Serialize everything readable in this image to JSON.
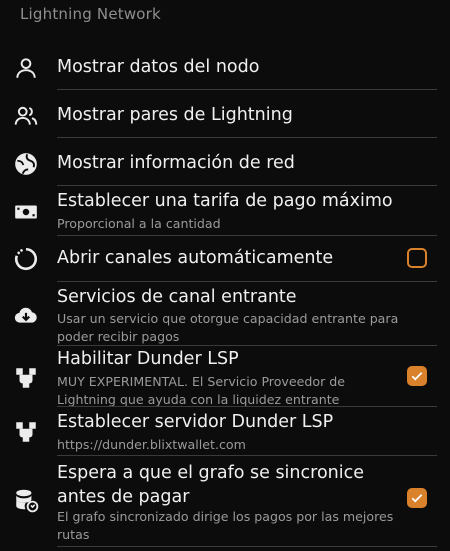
{
  "section": {
    "title": "Lightning Network"
  },
  "items": [
    {
      "icon": "person-icon",
      "title": "Mostrar datos del nodo"
    },
    {
      "icon": "people-icon",
      "title": "Mostrar pares de Lightning"
    },
    {
      "icon": "network-globe-icon",
      "title": "Mostrar información de red"
    },
    {
      "icon": "cash-icon",
      "title": "Establecer una tarifa de pago máximo",
      "subtitle": "Proporcional a la cantidad"
    },
    {
      "icon": "circle-progress-icon",
      "title": "Abrir canales automáticamente",
      "checked": false
    },
    {
      "icon": "cloud-download-icon",
      "title": "Servicios de canal entrante",
      "subtitle": "Usar un servicio que otorgue capacidad entrante para poder recibir pagos"
    },
    {
      "icon": "dunder-icon",
      "title": "Habilitar Dunder LSP",
      "subtitle": "MUY EXPERIMENTAL. El Servicio Proveedor de Lightning que ayuda con la liquidez entrante",
      "checked": true
    },
    {
      "icon": "dunder-icon",
      "title": "Establecer servidor Dunder LSP",
      "subtitle": "https://dunder.blixtwallet.com"
    },
    {
      "icon": "database-sync-icon",
      "title": "Espera a que el grafo se sincronice antes de pagar",
      "subtitle": "El grafo sincronizado dirige los pagos por las mejores rutas",
      "checked": true
    }
  ],
  "colors": {
    "background": "#0c0c0c",
    "accent": "#d9822b",
    "divider": "#3a3a3a",
    "subtitle": "#9a9a9a"
  }
}
